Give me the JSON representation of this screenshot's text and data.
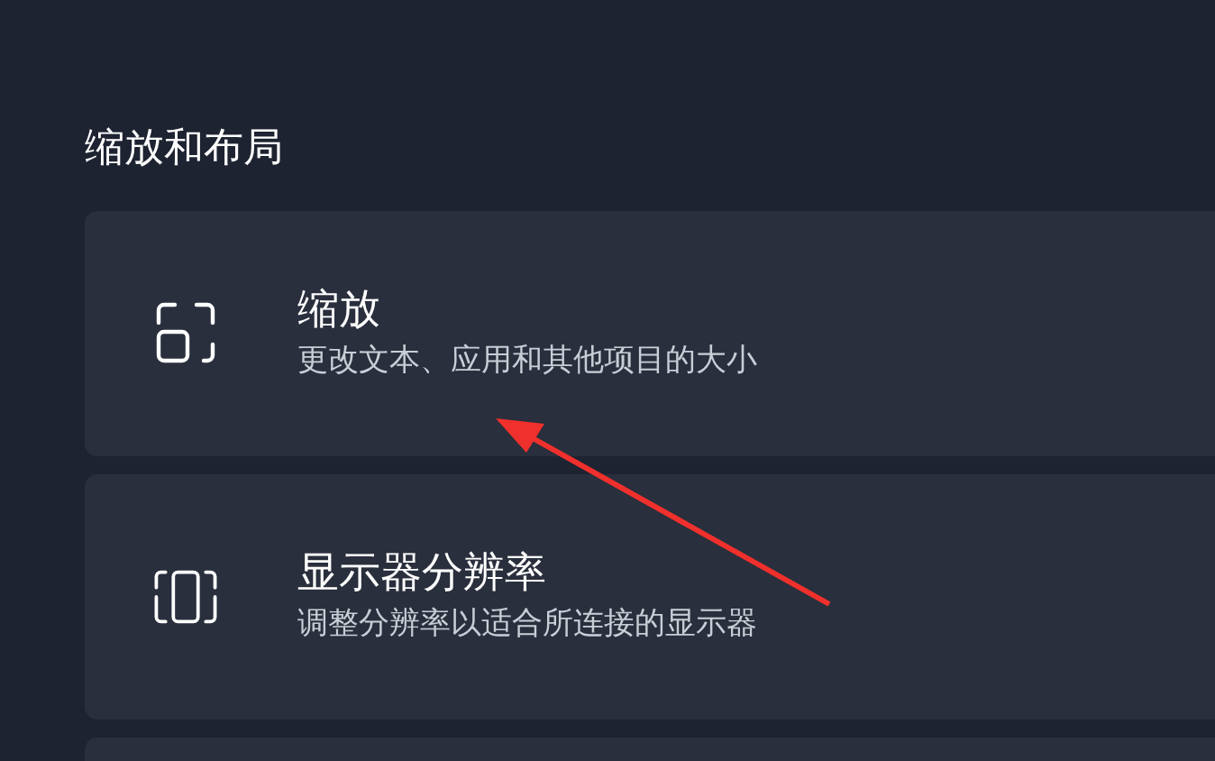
{
  "section_title": "缩放和布局",
  "cards": [
    {
      "kind": "scale",
      "title": "缩放",
      "subtitle": "更改文本、应用和其他项目的大小"
    },
    {
      "kind": "display",
      "title": "显示器分辨率",
      "subtitle": "调整分辨率以适合所连接的显示器"
    },
    {
      "kind": "empty"
    }
  ]
}
